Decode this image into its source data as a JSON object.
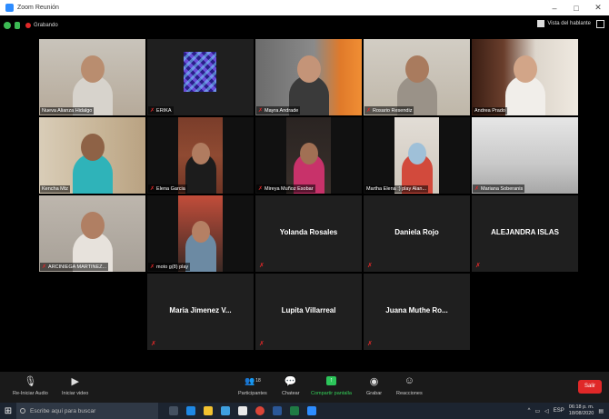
{
  "window": {
    "title": "Zoom Reunión",
    "controls": [
      "–",
      "□",
      "✕"
    ]
  },
  "topbar": {
    "recording_label": "Grabando",
    "view_label": "Vista del hablante"
  },
  "tiles": [
    {
      "name": "Nueva Alianza Hidalgo",
      "muted": false,
      "video": true
    },
    {
      "name": "ERIKA",
      "muted": true,
      "video": false
    },
    {
      "name": "Mayra Andrade",
      "muted": true,
      "video": true
    },
    {
      "name": "Rosario Resendiz",
      "muted": true,
      "video": true
    },
    {
      "name": "Andrea Prado",
      "muted": false,
      "video": true,
      "active": true
    },
    {
      "name": "Kencha Mtz",
      "muted": false,
      "video": true
    },
    {
      "name": "Elena Garcia",
      "muted": true,
      "video": true
    },
    {
      "name": "Mireya Muñoz Esobar",
      "muted": true,
      "video": true
    },
    {
      "name": "Martha Elena :) play Alan...",
      "muted": false,
      "video": true
    },
    {
      "name": "Mariana Soberanis",
      "muted": true,
      "video": true
    },
    {
      "name": "ARCINIEGA MARTINEZ...",
      "muted": true,
      "video": true
    },
    {
      "name": "moto g(8) play",
      "muted": true,
      "video": true
    },
    {
      "name": "Yolanda Rosales",
      "muted": true,
      "video": false
    },
    {
      "name": "Daniela Rojo",
      "muted": true,
      "video": false
    },
    {
      "name": "ALEJANDRA ISLAS",
      "muted": true,
      "video": false
    },
    {
      "name": "Maria Jimenez V...",
      "muted": true,
      "video": false
    },
    {
      "name": "Lupita Villarreal",
      "muted": true,
      "video": false
    },
    {
      "name": "Juana Muthe Ro...",
      "muted": true,
      "video": false
    }
  ],
  "toolbar": {
    "audio_label": "Re-Iniciar Audio",
    "video_label": "Iniciar video",
    "participants_label": "Participantes",
    "participants_count": "18",
    "chat_label": "Chatear",
    "share_label": "Compartir pantalla",
    "record_label": "Grabar",
    "reactions_label": "Reacciones",
    "end_label": "Salir"
  },
  "taskbar": {
    "search_placeholder": "Escribe aquí para buscar",
    "lang": "ESP",
    "time": "06:18 p. m.",
    "date": "18/08/2020"
  },
  "colors": {
    "active_speaker_outline": "#dfe55a",
    "muted_red": "#e02828",
    "share_green": "#2cc55a"
  }
}
